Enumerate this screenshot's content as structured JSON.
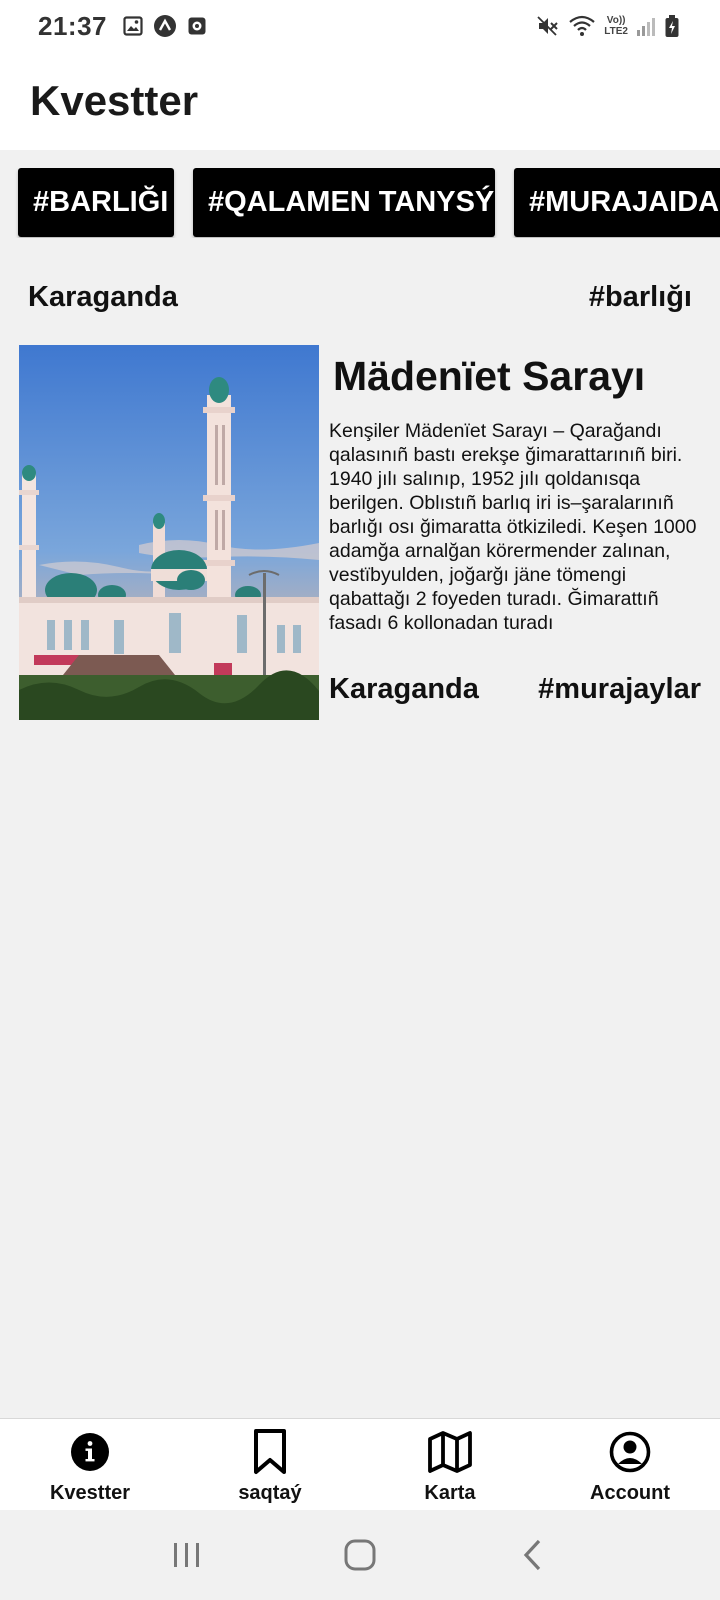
{
  "status_bar": {
    "time": "21:37",
    "icons_left": [
      "image-icon",
      "arrow-up-icon",
      "record-icon"
    ],
    "icons_right": [
      "mute-icon",
      "wifi-icon",
      "volte-icon",
      "signal-icon",
      "battery-icon"
    ],
    "volte_line1": "Vo))",
    "volte_line2": "LTE2"
  },
  "header": {
    "title": "Kvestter"
  },
  "categories": {
    "chips": [
      "#BARLIĞI",
      "#QALAMEN TANYSÝ",
      "#MURAJAIDAĞ"
    ]
  },
  "filters": {
    "city": "Karaganda",
    "category": "#barlığı"
  },
  "card": {
    "title": "Mädenïet Sarayı",
    "description": "Kenşiler Mädenïet Sarayı – Qarağandı qalasınıñ bastı erekşe ğimarattarınıñ biri. 1940 jılı salınıp, 1952 jılı qoldanısqa berilgen. Oblıstıñ barlıq iri is–şaralarınıñ barlığı osı ğimaratta ötkiziledi. Keşen 1000 adamğa arnalğan körermender zalınan, vestïbyulden, joğarğı jäne tömengi qabattağı 2 foyeden turadı. Ğimarattıñ fasadı 6 kollonadan turadı",
    "city": "Karaganda",
    "tag": "#murajaylar",
    "image_icon": "mosque-photo"
  },
  "bottom_nav": {
    "items": [
      {
        "label": "Kvestter",
        "icon": "info-icon"
      },
      {
        "label": "saqtaý",
        "icon": "bookmark-icon"
      },
      {
        "label": "Karta",
        "icon": "map-icon"
      },
      {
        "label": "Account",
        "icon": "account-icon"
      }
    ]
  },
  "system_nav": {
    "buttons": [
      "recent-apps-icon",
      "home-icon",
      "back-icon"
    ]
  },
  "colors": {
    "chip_bg": "#000000",
    "chip_text": "#ffffff",
    "page_bg": "#f1f1f1",
    "bar_bg": "#ffffff"
  }
}
